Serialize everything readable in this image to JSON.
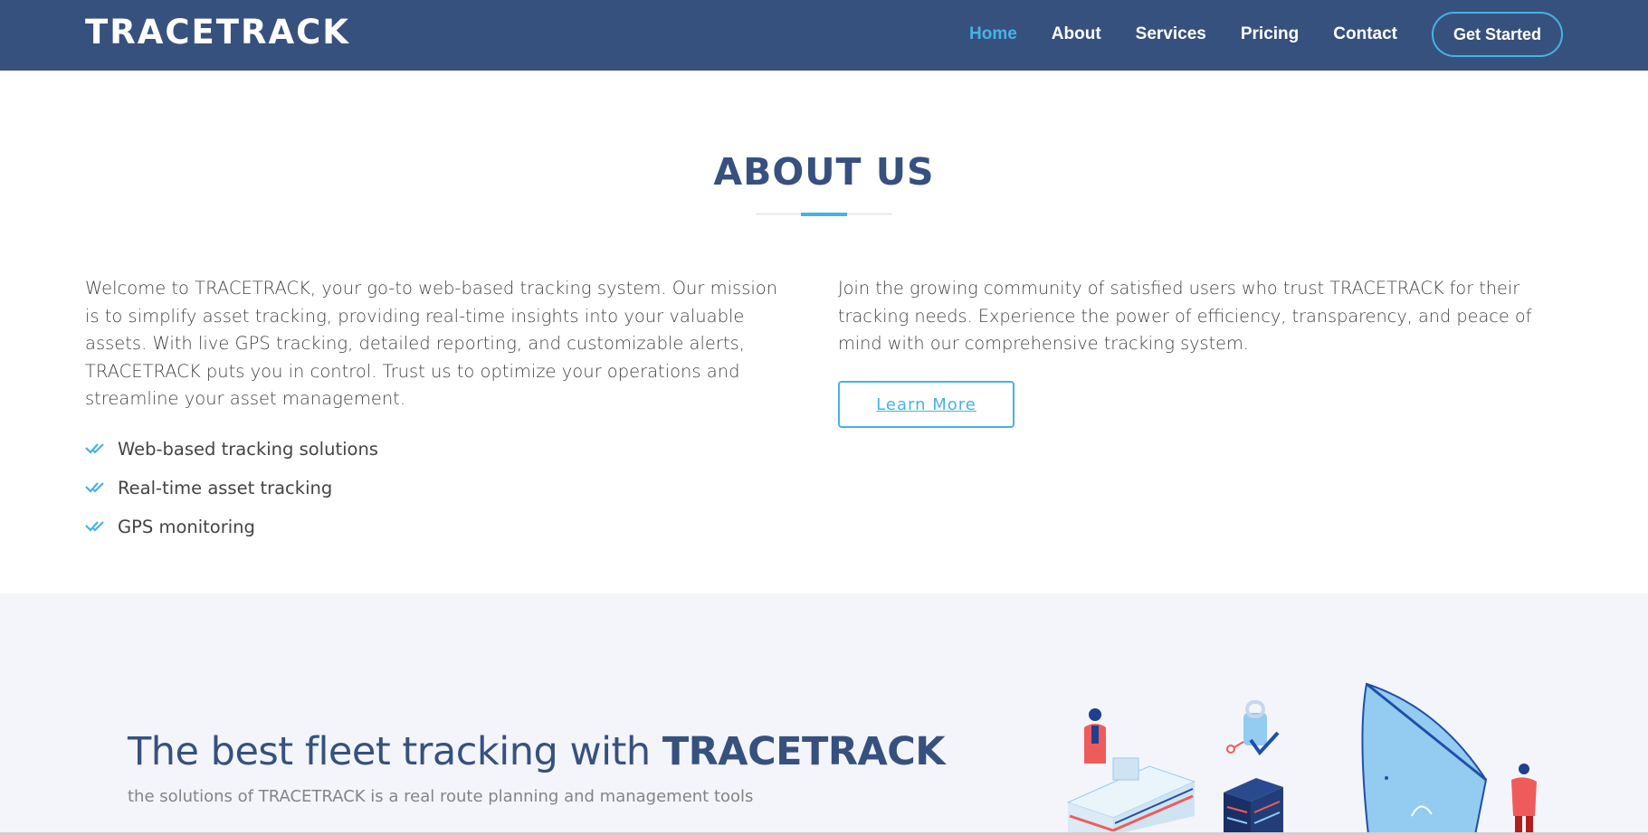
{
  "header": {
    "logo": "TRACETRACK",
    "nav": [
      "Home",
      "About",
      "Services",
      "Pricing",
      "Contact"
    ],
    "active_nav": "Home",
    "cta": "Get Started"
  },
  "about": {
    "title": "ABOUT US",
    "left_paragraph": "Welcome to TRACETRACK, your go-to web-based tracking system. Our mission is to simplify asset tracking, providing real-time insights into your valuable assets. With live GPS tracking, detailed reporting, and customizable alerts, TRACETRACK puts you in control. Trust us to optimize your operations and streamline your asset management.",
    "features": [
      "Web-based tracking solutions",
      "Real-time asset tracking",
      "GPS monitoring"
    ],
    "right_paragraph": "Join the growing community of satisfied users who trust TRACETRACK for their tracking needs. Experience the power of efficiency, transparency, and peace of mind with our comprehensive tracking system.",
    "learn_more": "Learn More"
  },
  "why": {
    "title_prefix": "The best fleet tracking with ",
    "title_brand": "TRACETRACK",
    "subtitle": "the solutions of TRACETRACK is a real route planning and management tools"
  },
  "colors": {
    "primary": "#37517e",
    "accent": "#47b2e4",
    "section_bg": "#f3f5fa",
    "illustration_red": "#ef5b5b",
    "illustration_light_blue": "#93cbf1"
  },
  "icons": {
    "check": "double-check-icon",
    "illustration": "fleet-security-illustration"
  }
}
